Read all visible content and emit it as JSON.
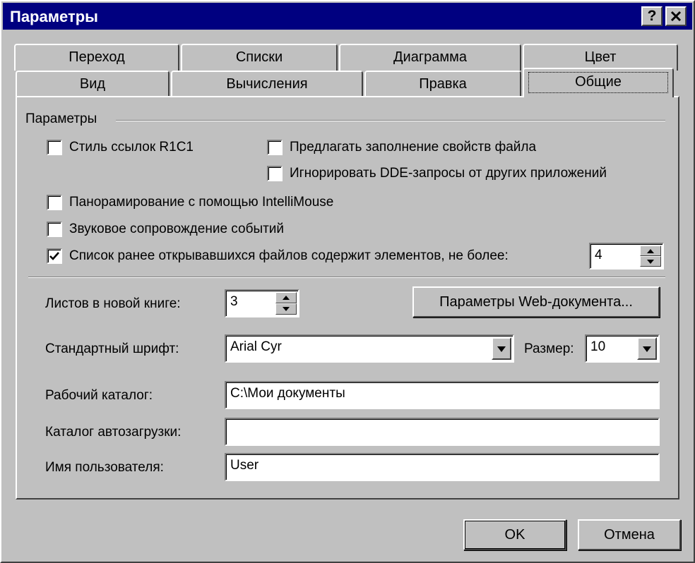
{
  "window": {
    "title": "Параметры",
    "help_button": "?",
    "close_button": "✕"
  },
  "tabs": {
    "back_row": [
      "Переход",
      "Списки",
      "Диаграмма",
      "Цвет"
    ],
    "front_row": [
      "Вид",
      "Вычисления",
      "Правка",
      "Общие"
    ],
    "active": "Общие"
  },
  "settings_group": {
    "label": "Параметры",
    "checkboxes": [
      {
        "label": "Стиль ссылок R1C1",
        "checked": false
      },
      {
        "label": "Предлагать заполнение свойств файла",
        "checked": false
      },
      {
        "label": "Игнорировать DDE-запросы от других приложений",
        "checked": false
      },
      {
        "label": "Панорамирование с помощью IntelliMouse",
        "checked": false
      },
      {
        "label": "Звуковое сопровождение событий",
        "checked": false
      },
      {
        "label": "Список ранее открывавшихся файлов содержит элементов, не более:",
        "checked": true
      }
    ],
    "recent_files_count": "4"
  },
  "sheets": {
    "label": "Листов в новой книге:",
    "value": "3"
  },
  "web_options_button": "Параметры Web-документа...",
  "font": {
    "label": "Стандартный шрифт:",
    "value": "Arial Cyr",
    "size_label": "Размер:",
    "size_value": "10"
  },
  "work_dir": {
    "label": "Рабочий каталог:",
    "value": "C:\\Мои документы"
  },
  "autoload_dir": {
    "label": "Каталог автозагрузки:",
    "value": ""
  },
  "user_name": {
    "label": "Имя пользователя:",
    "value": "User"
  },
  "buttons": {
    "ok": "OK",
    "cancel": "Отмена"
  },
  "colors": {
    "titlebar": "#000080",
    "face": "#c0c0c0",
    "field": "#ffffff"
  }
}
